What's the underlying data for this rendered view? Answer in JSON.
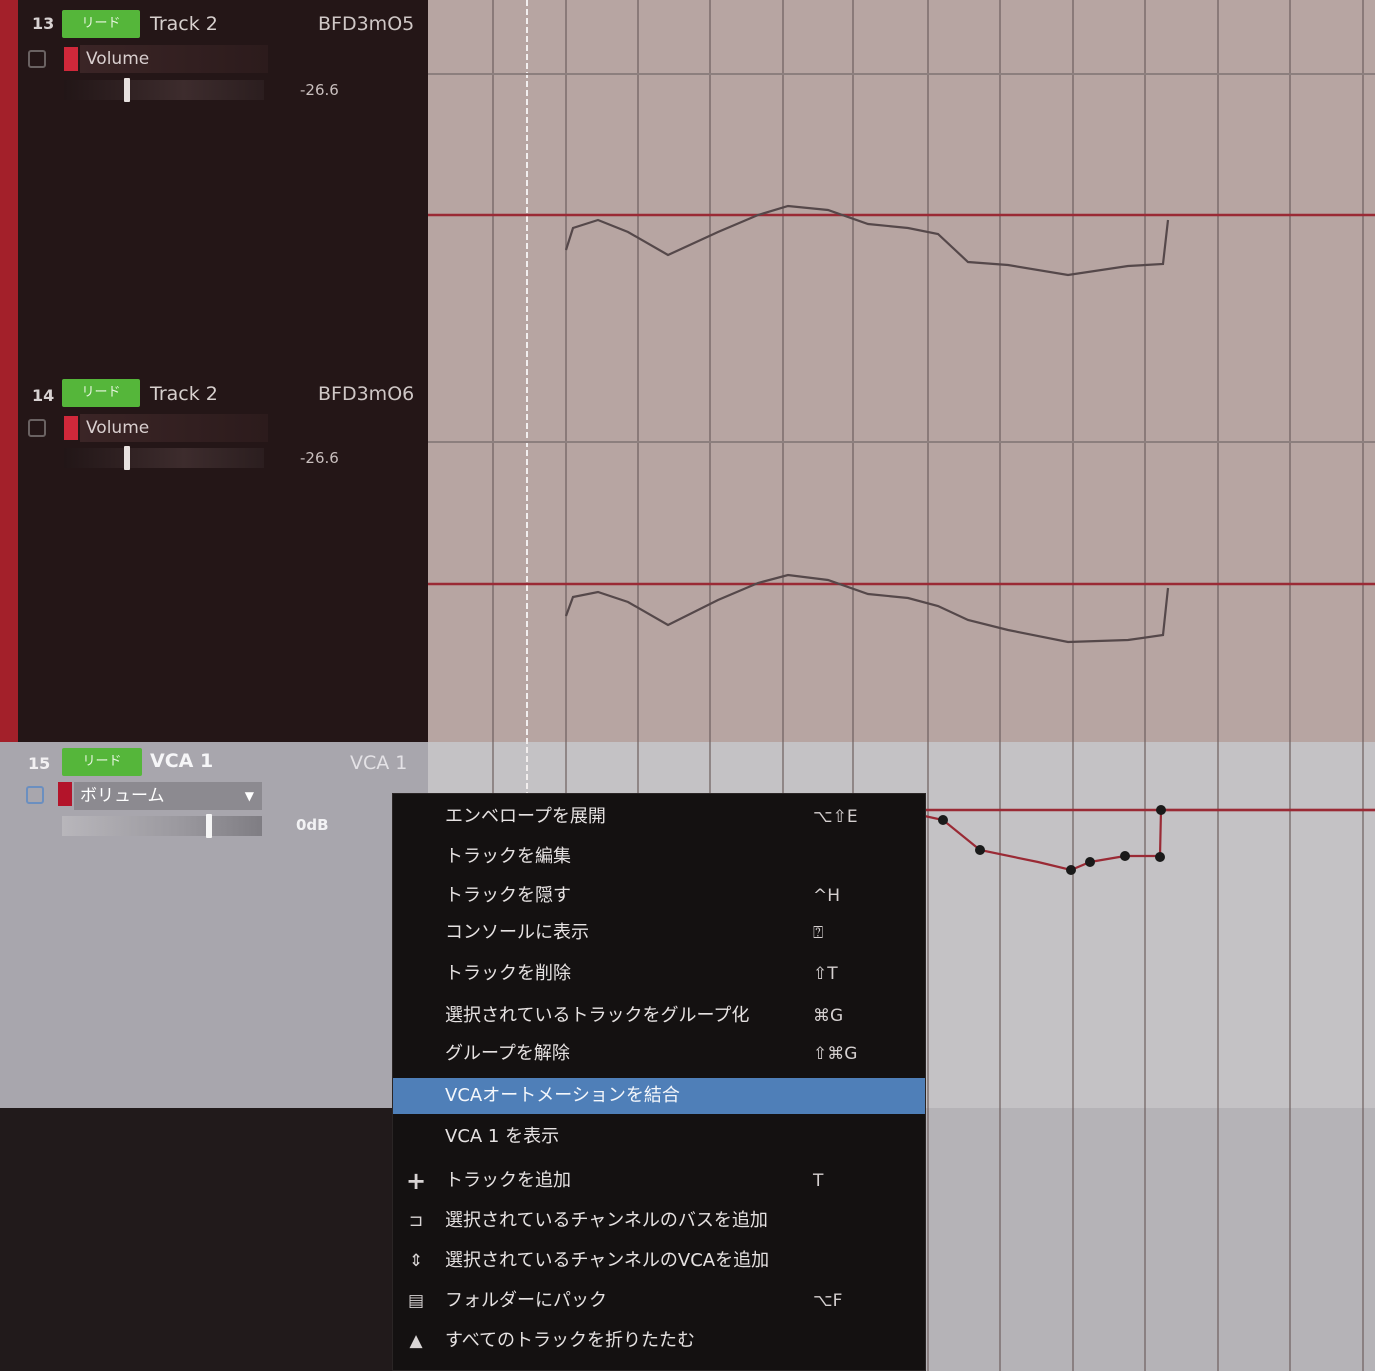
{
  "tracks": [
    {
      "number": "13",
      "mode": "リード",
      "name": "Track 2",
      "input": "BFD3mO5",
      "param": "Volume",
      "value": "-26.6"
    },
    {
      "number": "14",
      "mode": "リード",
      "name": "Track 2",
      "input": "BFD3mO6",
      "param": "Volume",
      "value": "-26.6"
    }
  ],
  "vca": {
    "number": "15",
    "mode": "リード",
    "name": "VCA 1",
    "input": "VCA 1",
    "param": "ボリューム",
    "value": "0dB"
  },
  "context_menu": {
    "items": [
      {
        "label": "エンベロープを展開",
        "shortcut": "⌥⇧E",
        "icon": ""
      },
      {
        "label": "トラックを編集",
        "shortcut": "",
        "icon": ""
      },
      {
        "label": "トラックを隠す",
        "shortcut": "^H",
        "icon": ""
      },
      {
        "label": "コンソールに表示",
        "shortcut": "⍰",
        "icon": ""
      },
      {
        "label": "トラックを削除",
        "shortcut": "⇧T",
        "icon": ""
      },
      {
        "label": "選択されているトラックをグループ化",
        "shortcut": "⌘G",
        "icon": ""
      },
      {
        "label": "グループを解除",
        "shortcut": "⇧⌘G",
        "icon": ""
      },
      {
        "label": "VCAオートメーションを結合",
        "shortcut": "",
        "icon": ""
      },
      {
        "label": "VCA 1 を表示",
        "shortcut": "",
        "icon": ""
      },
      {
        "label": "トラックを追加",
        "shortcut": "T",
        "icon": "plus-icon"
      },
      {
        "label": "選択されているチャンネルのバスを追加",
        "shortcut": "",
        "icon": "bus-icon"
      },
      {
        "label": "選択されているチャンネルのVCAを追加",
        "shortcut": "",
        "icon": "vca-icon"
      },
      {
        "label": "フォルダーにパック",
        "shortcut": "⌥F",
        "icon": "folder-icon"
      },
      {
        "label": "すべてのトラックを折りたたむ",
        "shortcut": "",
        "icon": "collapse-icon"
      }
    ],
    "highlighted_index": 7
  },
  "colors": {
    "track_accent": "#a3202a",
    "mode_button": "#55b63a",
    "lane_bg": "#b7a5a2",
    "vca_lane_bg": "#c4c2c5",
    "automation_line": "#9a2a35",
    "menu_highlight": "#4f7fb8"
  }
}
